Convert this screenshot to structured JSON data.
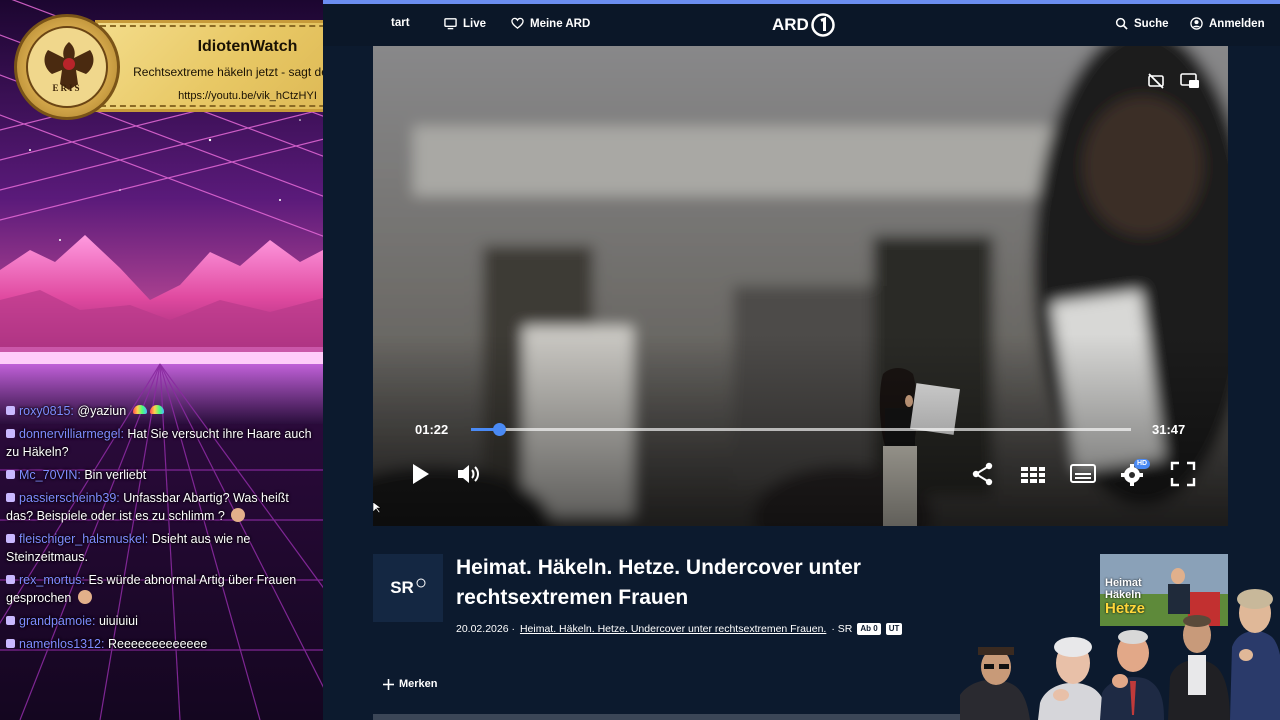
{
  "overlay": {
    "logo_text": "ERIS",
    "title": "IdiotenWatch",
    "subtitle": "Rechtsextreme häkeln jetzt - sagt der ÖRR",
    "url": "https://youtu.be/vik_hCtzHYI"
  },
  "chat": [
    {
      "user": "roxy0815:",
      "text": "@yaziun"
    },
    {
      "user": "donnervilliarmegel:",
      "text": "Hat Sie versucht ihre Haare auch zu Häkeln?"
    },
    {
      "user": "Mc_70VIN:",
      "text": "Bin verliebt"
    },
    {
      "user": "passierscheinb39:",
      "text": "Unfassbar Abartig? Was heißt das? Beispiele oder ist es zu schlimm ?"
    },
    {
      "user": "fleischiger_halsmuskel:",
      "text": "Dsieht aus wie ne Steinzeitmaus."
    },
    {
      "user": "rex_mortus:",
      "text": "Es würde abnormal Artig über Frauen gesprochen"
    },
    {
      "user": "grandpamoie:",
      "text": "uiuiuiui"
    },
    {
      "user": "namenlos1312:",
      "text": "Reeeeeeeeeeeee"
    }
  ],
  "nav": {
    "start": "tart",
    "live": "Live",
    "meine_ard": "Meine ARD",
    "logo": "ARD",
    "search": "Suche",
    "login": "Anmelden"
  },
  "player": {
    "current_time": "01:22",
    "total_time": "31:47",
    "progress_percent": 4.3,
    "settings_badge": "HD"
  },
  "episode": {
    "channel": "SR",
    "title": "Heimat. Häkeln. Hetze. Undercover unter rechtsextremen Frauen",
    "date": "20.02.2026 ·",
    "link": "Heimat. Häkeln. Hetze. Undercover unter rechtsextremen Frauen.",
    "channel_suffix": "· SR",
    "badge_ad": "Ab 0",
    "badge_ut": "UT",
    "merken": "Merken"
  },
  "thumbnail": {
    "line1": "Heimat",
    "line2": "Häkeln",
    "line3": "Hetze"
  },
  "colors": {
    "accent": "#4a8af5",
    "page_bg": "#0c1a2e",
    "chat_user": "#7f8cff",
    "card_gold": "#e8c865"
  }
}
